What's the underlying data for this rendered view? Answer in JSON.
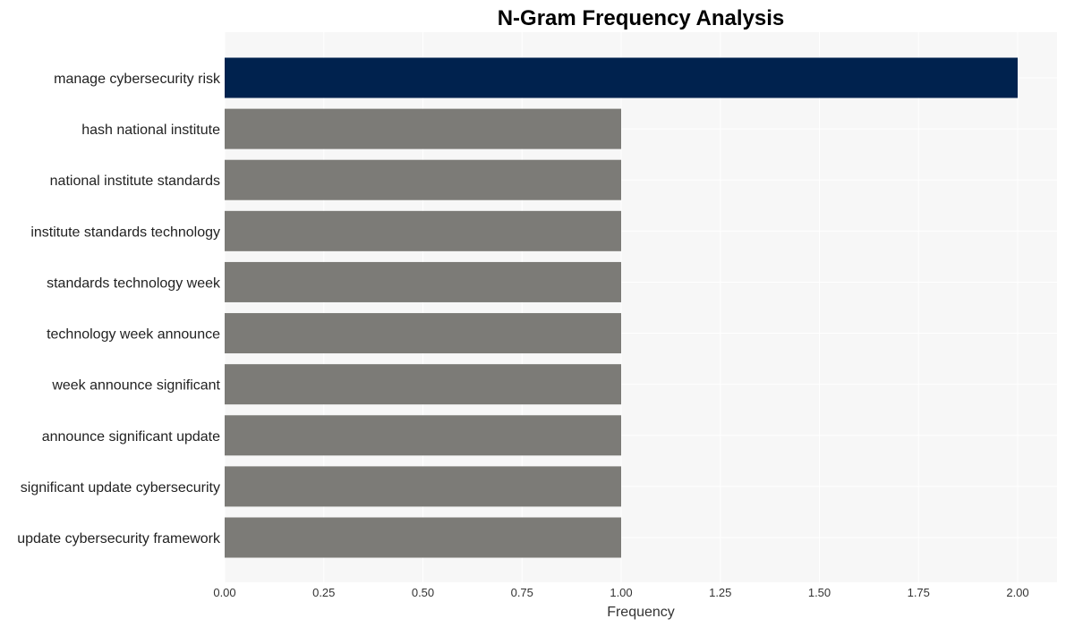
{
  "chart_data": {
    "type": "bar",
    "orientation": "horizontal",
    "title": "N-Gram Frequency Analysis",
    "xlabel": "Frequency",
    "ylabel": "",
    "xlim": [
      0,
      2.1
    ],
    "xticks": [
      "0.00",
      "0.25",
      "0.50",
      "0.75",
      "1.00",
      "1.25",
      "1.50",
      "1.75",
      "2.00"
    ],
    "grid": true,
    "categories": [
      "manage cybersecurity risk",
      "hash national institute",
      "national institute standards",
      "institute standards technology",
      "standards technology week",
      "technology week announce",
      "week announce significant",
      "announce significant update",
      "significant update cybersecurity",
      "update cybersecurity framework"
    ],
    "values": [
      2,
      1,
      1,
      1,
      1,
      1,
      1,
      1,
      1,
      1
    ],
    "colors": {
      "highlight": "#00224e",
      "default": "#7c7b77",
      "plot_background": "#f7f7f7",
      "grid": "#ffffff"
    }
  }
}
